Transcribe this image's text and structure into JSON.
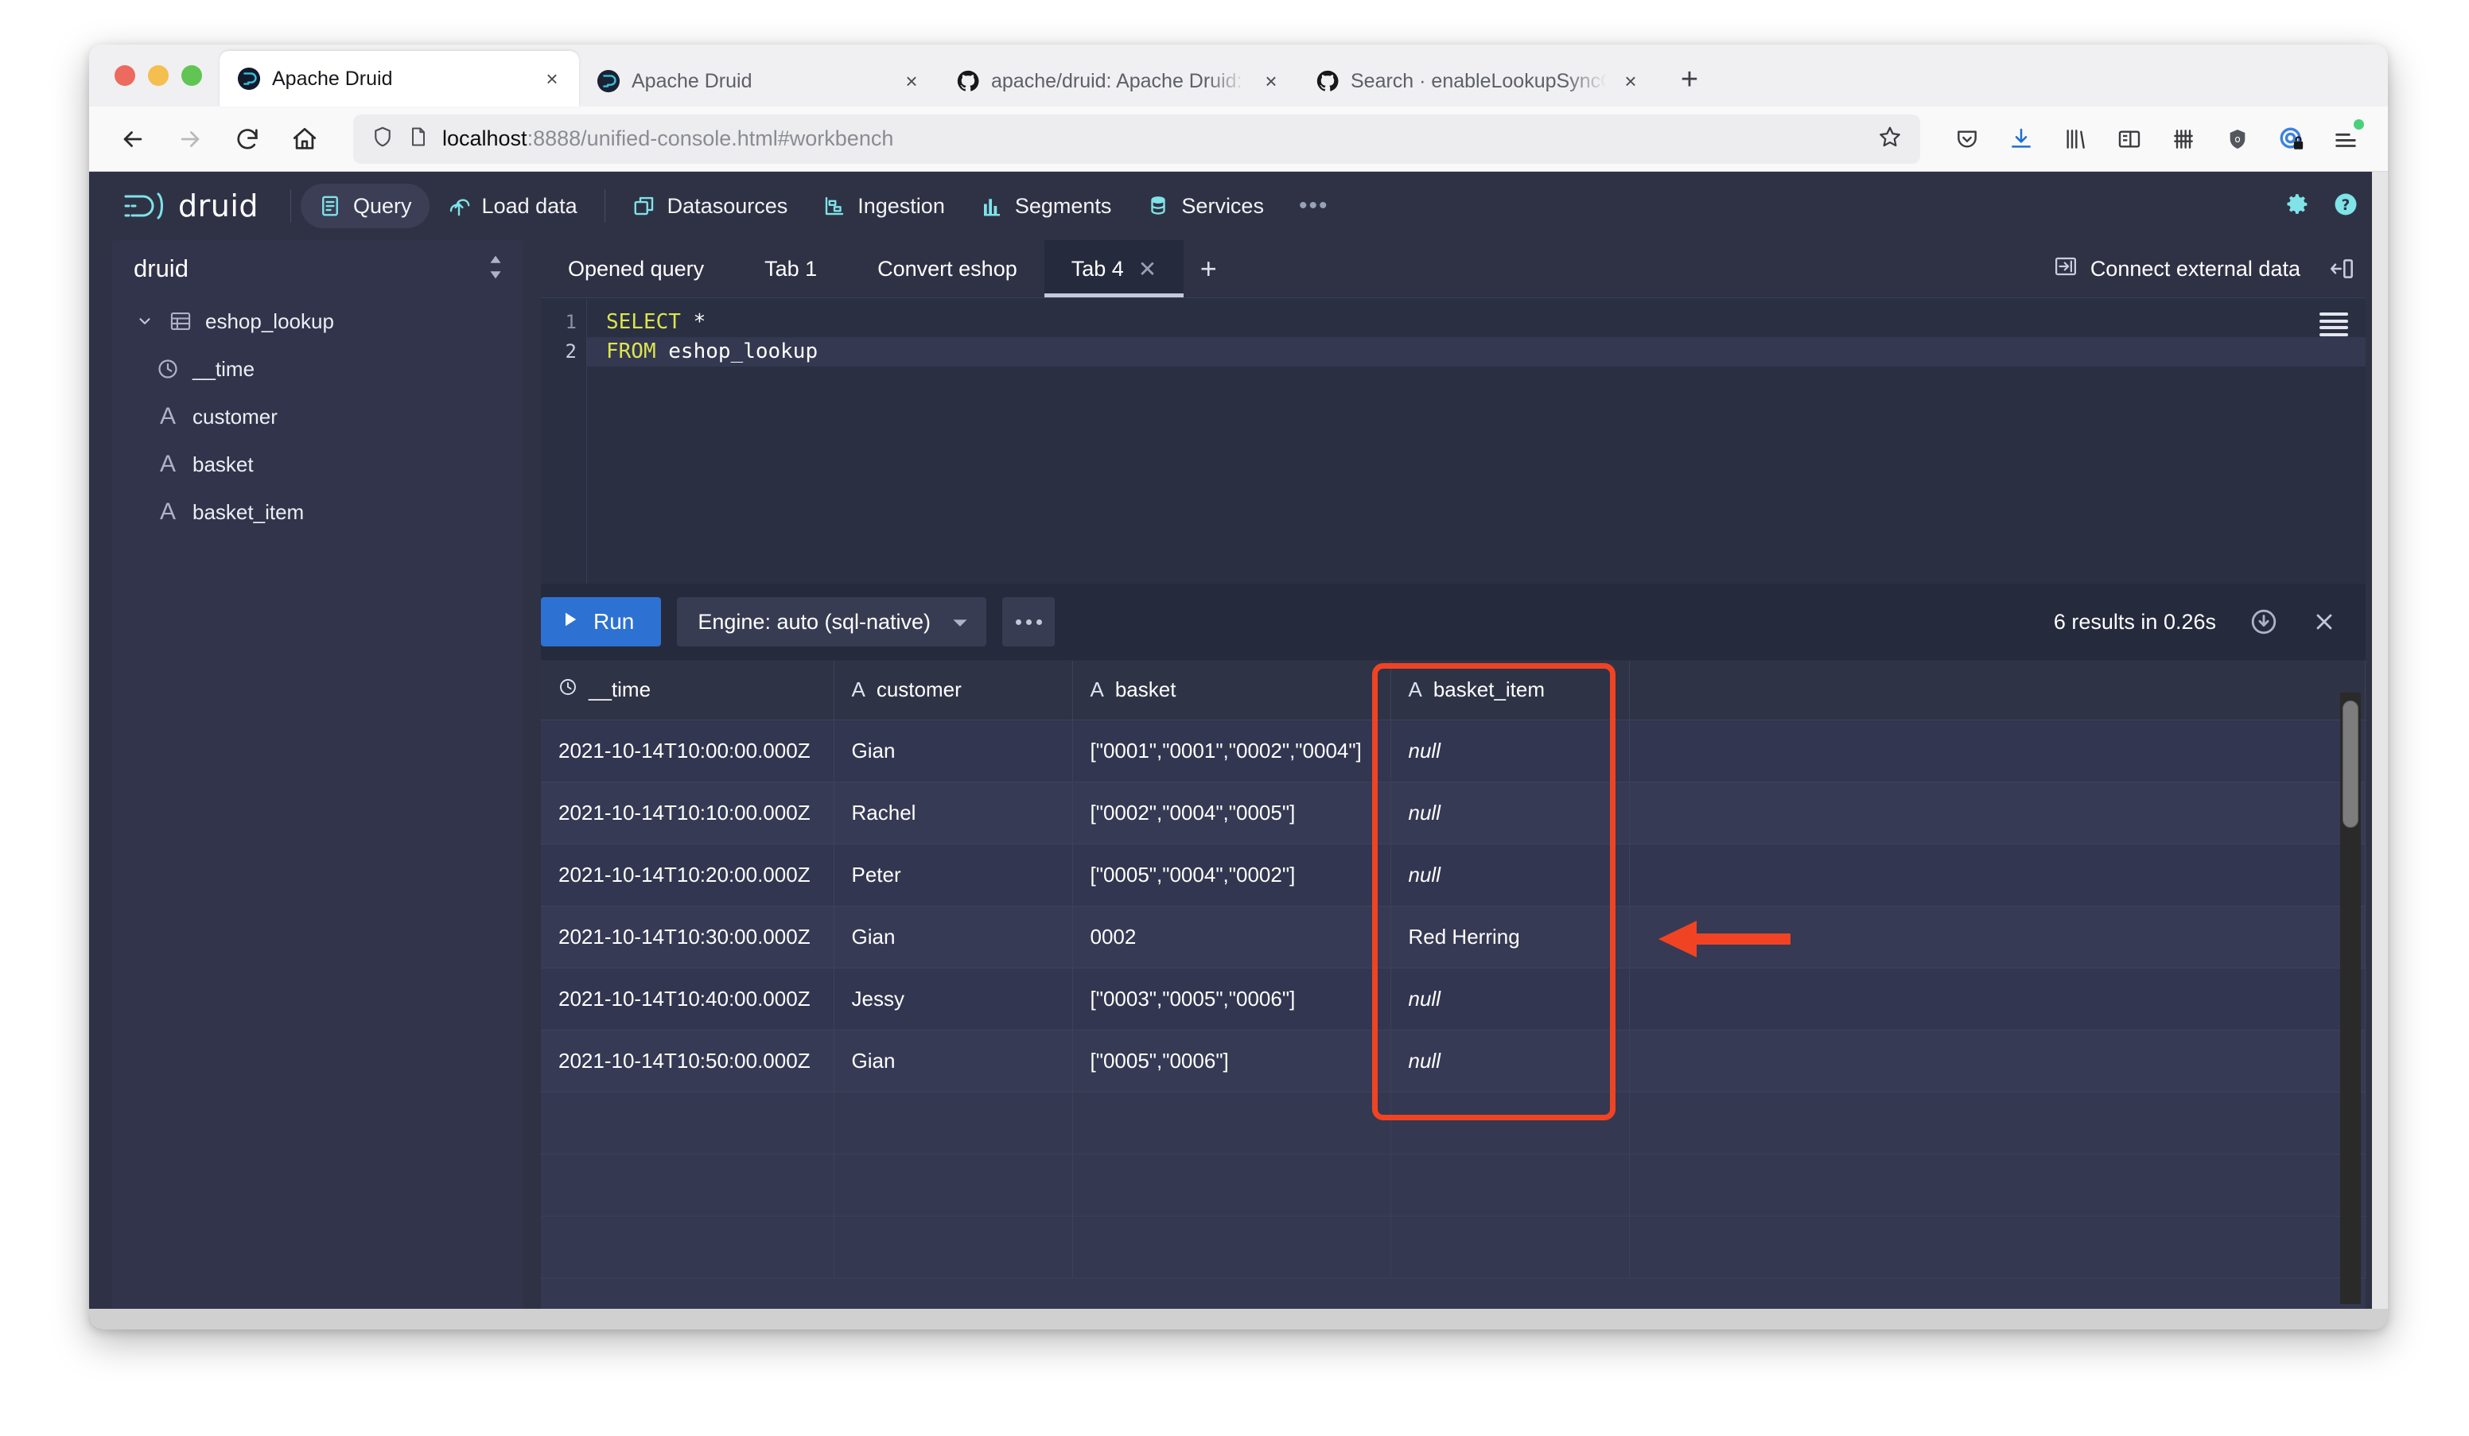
{
  "browser": {
    "traffic_lights": [
      "close",
      "minimize",
      "maximize"
    ],
    "tabs": [
      {
        "label": "Apache Druid",
        "favicon": "druid-icon",
        "active": true
      },
      {
        "label": "Apache Druid",
        "favicon": "druid-icon",
        "active": false
      },
      {
        "label": "apache/druid: Apache Druid: a h",
        "favicon": "github-icon",
        "active": false
      },
      {
        "label": "Search · enableLookupSyncOnS",
        "favicon": "github-icon",
        "active": false
      }
    ],
    "new_tab_label": "+",
    "close_label": "×",
    "nav": {
      "back": "back-arrow",
      "forward": "forward-arrow",
      "reload": "reload",
      "home": "home"
    },
    "url": {
      "host": "localhost",
      "rest": ":8888/unified-console.html#workbench",
      "full": "localhost:8888/unified-console.html#workbench"
    },
    "toolbar_icons": [
      "pocket-icon",
      "downloads-icon",
      "library-icon",
      "sidebar-icon",
      "containers-icon",
      "shield-icon",
      "privacy-icon",
      "app-menu-icon"
    ]
  },
  "druid": {
    "logo_text": "druid",
    "nav_items": [
      {
        "label": "Query",
        "icon": "query-icon",
        "active": true
      },
      {
        "label": "Load data",
        "icon": "load-data-icon",
        "active": false
      },
      {
        "label": "Datasources",
        "icon": "datasources-icon",
        "active": false
      },
      {
        "label": "Ingestion",
        "icon": "ingestion-icon",
        "active": false
      },
      {
        "label": "Segments",
        "icon": "segments-icon",
        "active": false
      },
      {
        "label": "Services",
        "icon": "services-icon",
        "active": false
      }
    ],
    "nav_more": "•••",
    "header_right": [
      "gear-icon",
      "help-icon"
    ],
    "accent_teal": "#7fe3e8",
    "accent_blue": "#2d72d2",
    "annotation_red": "#f04324"
  },
  "sidebar": {
    "schema": "druid",
    "sort_icon": "sort-updown-icon",
    "tree": [
      {
        "label": "eshop_lookup",
        "icon": "table-icon",
        "caret": "chevron-down-icon",
        "level": 0
      },
      {
        "label": "__time",
        "icon": "clock-icon",
        "level": 1
      },
      {
        "label": "customer",
        "icon": "string-icon",
        "level": 1
      },
      {
        "label": "basket",
        "icon": "string-icon",
        "level": 1
      },
      {
        "label": "basket_item",
        "icon": "string-icon",
        "level": 1
      }
    ]
  },
  "query_tabs": {
    "tabs": [
      {
        "label": "Opened query",
        "active": false,
        "closable": false
      },
      {
        "label": "Tab 1",
        "active": false,
        "closable": false
      },
      {
        "label": "Convert eshop",
        "active": false,
        "closable": false
      },
      {
        "label": "Tab 4",
        "active": true,
        "closable": true
      }
    ],
    "close_label": "✕",
    "add_label": "+",
    "connect_external_data": "Connect external data",
    "connect_icon": "connect-external-data-icon",
    "collapse_icon": "collapse-panel-icon"
  },
  "editor": {
    "line_numbers": [
      "1",
      "2"
    ],
    "lines": [
      {
        "keyword": "SELECT",
        "rest": " *"
      },
      {
        "keyword": "FROM",
        "rest": " eshop_lookup"
      }
    ],
    "menu_icon": "editor-menu-icon",
    "current_line": 2
  },
  "runbar": {
    "run_label": "Run",
    "run_icon": "play-icon",
    "engine_label": "Engine: auto (sql-native)",
    "engine_caret": "chevron-down-icon",
    "more_icon": "more-icon",
    "results_status": "6 results in 0.26s",
    "download_icon": "download-circle-icon",
    "close_icon": "close-icon"
  },
  "results": {
    "columns": [
      {
        "name": "__time",
        "type_icon": "clock-icon",
        "highlighted": false
      },
      {
        "name": "customer",
        "type_icon": "string-icon",
        "highlighted": false
      },
      {
        "name": "basket",
        "type_icon": "string-icon",
        "highlighted": false
      },
      {
        "name": "basket_item",
        "type_icon": "string-icon",
        "highlighted": true
      }
    ],
    "rows": [
      {
        "__time": "2021-10-14T10:00:00.000Z",
        "customer": "Gian",
        "basket": "[\"0001\",\"0001\",\"0002\",\"0004\"]",
        "basket_item": "null",
        "basket_item_is_null": true
      },
      {
        "__time": "2021-10-14T10:10:00.000Z",
        "customer": "Rachel",
        "basket": "[\"0002\",\"0004\",\"0005\"]",
        "basket_item": "null",
        "basket_item_is_null": true
      },
      {
        "__time": "2021-10-14T10:20:00.000Z",
        "customer": "Peter",
        "basket": "[\"0005\",\"0004\",\"0002\"]",
        "basket_item": "null",
        "basket_item_is_null": true
      },
      {
        "__time": "2021-10-14T10:30:00.000Z",
        "customer": "Gian",
        "basket": "0002",
        "basket_item": "Red Herring",
        "basket_item_is_null": false
      },
      {
        "__time": "2021-10-14T10:40:00.000Z",
        "customer": "Jessy",
        "basket": "[\"0003\",\"0005\",\"0006\"]",
        "basket_item": "null",
        "basket_item_is_null": true
      },
      {
        "__time": "2021-10-14T10:50:00.000Z",
        "customer": "Gian",
        "basket": "[\"0005\",\"0006\"]",
        "basket_item": "null",
        "basket_item_is_null": true
      }
    ],
    "blank_row_count": 3,
    "annotations": {
      "highlight_box": "basket_item column highlighted",
      "arrow": "arrow pointing left at Red Herring row"
    }
  }
}
